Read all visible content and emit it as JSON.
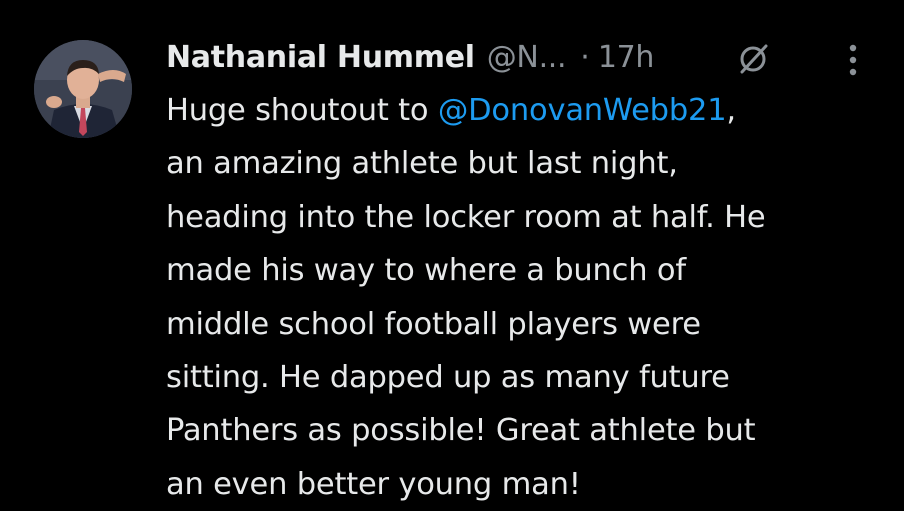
{
  "author": {
    "name": "Nathanial Hummel",
    "handle": "@N...",
    "separator": "·",
    "time": "17h"
  },
  "icons": {
    "avatar": "profile-photo",
    "mute": "muted-slash-circle-icon",
    "more": "vertical-ellipsis-icon"
  },
  "colors": {
    "background": "#000000",
    "text": "#e7e9ea",
    "muted": "#8b9197",
    "mention": "#1d9bf0"
  },
  "tweet": {
    "line1_prefix": "Huge shoutout to ",
    "mention": "@DonovanWebb21",
    "line1_suffix": ",",
    "line2": "an amazing athlete but last night,",
    "line3": "heading into the locker room at half. He",
    "line4": "made his way to where a bunch of",
    "line5": "middle school football players were",
    "line6": "sitting. He dapped up as many future",
    "line7": "Panthers as possible! Great athlete but",
    "line8": "an even better young man!"
  }
}
